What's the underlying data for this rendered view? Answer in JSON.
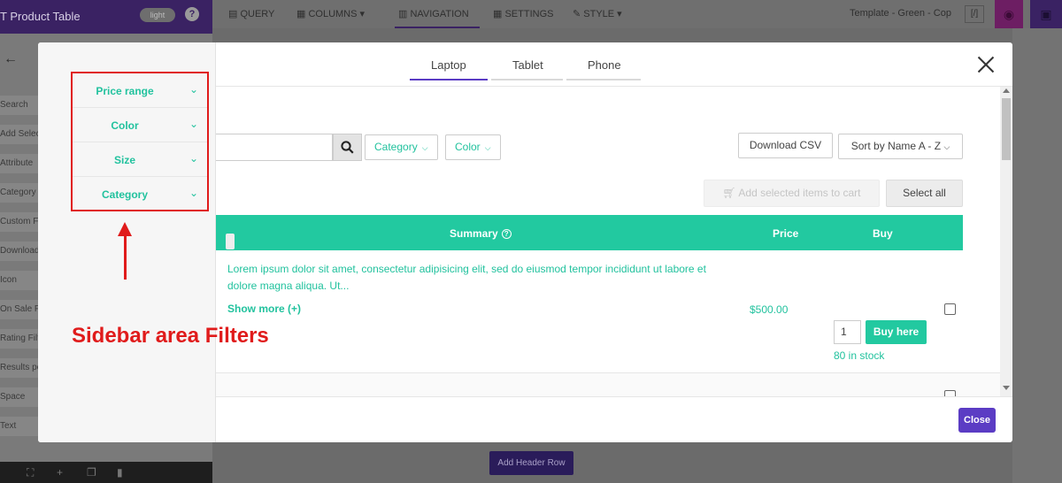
{
  "colors": {
    "accent": "#22c9a0",
    "annotation": "#e01b1b",
    "brand_purple": "#5b3cc4"
  },
  "editor": {
    "app_title": "T Product Table",
    "theme_toggle": "light",
    "help": "?",
    "back_icon": "arrow-left-icon",
    "left_items": [
      "Search",
      "Add Selec",
      "Attribute",
      "Category",
      "Custom Fi",
      "Download",
      "Icon",
      "On Sale Fi",
      "Rating Filt",
      "Results pe",
      "Space",
      "Text"
    ],
    "toolbar": [
      {
        "icon": "query-icon",
        "label": "QUERY"
      },
      {
        "icon": "columns-icon",
        "label": "COLUMNS ▾"
      },
      {
        "icon": "navigation-icon",
        "label": "NAVIGATION"
      },
      {
        "icon": "settings-icon",
        "label": "SETTINGS"
      },
      {
        "icon": "style-icon",
        "label": "STYLE ▾"
      }
    ],
    "template_label": "Template - Green - Cop",
    "add_header_row": "Add Header Row"
  },
  "modal": {
    "device_tabs": [
      "Laptop",
      "Tablet",
      "Phone"
    ],
    "active_tab": "Laptop",
    "filters": [
      "Price range",
      "Color",
      "Size",
      "Category"
    ],
    "annotation": "Sidebar area Filters",
    "search": {
      "placeholder": "",
      "icon": "search-icon"
    },
    "dropdowns": [
      "Category",
      "Color"
    ],
    "download_csv": "Download CSV",
    "sort": "Sort by Name A - Z",
    "add_to_cart": "Add selected items to cart",
    "select_all": "Select all",
    "columns": [
      "Summary",
      "Price",
      "Buy"
    ],
    "row": {
      "summary": "Lorem ipsum dolor sit amet, consectetur adipisicing elit, sed do eiusmod tempor incididunt ut labore et dolore magna aliqua. Ut...",
      "show_more": "Show more (+)",
      "price": "$500.00",
      "quantity": "1",
      "buy_button": "Buy here",
      "stock": "80 in stock"
    },
    "close_button": "Close"
  }
}
